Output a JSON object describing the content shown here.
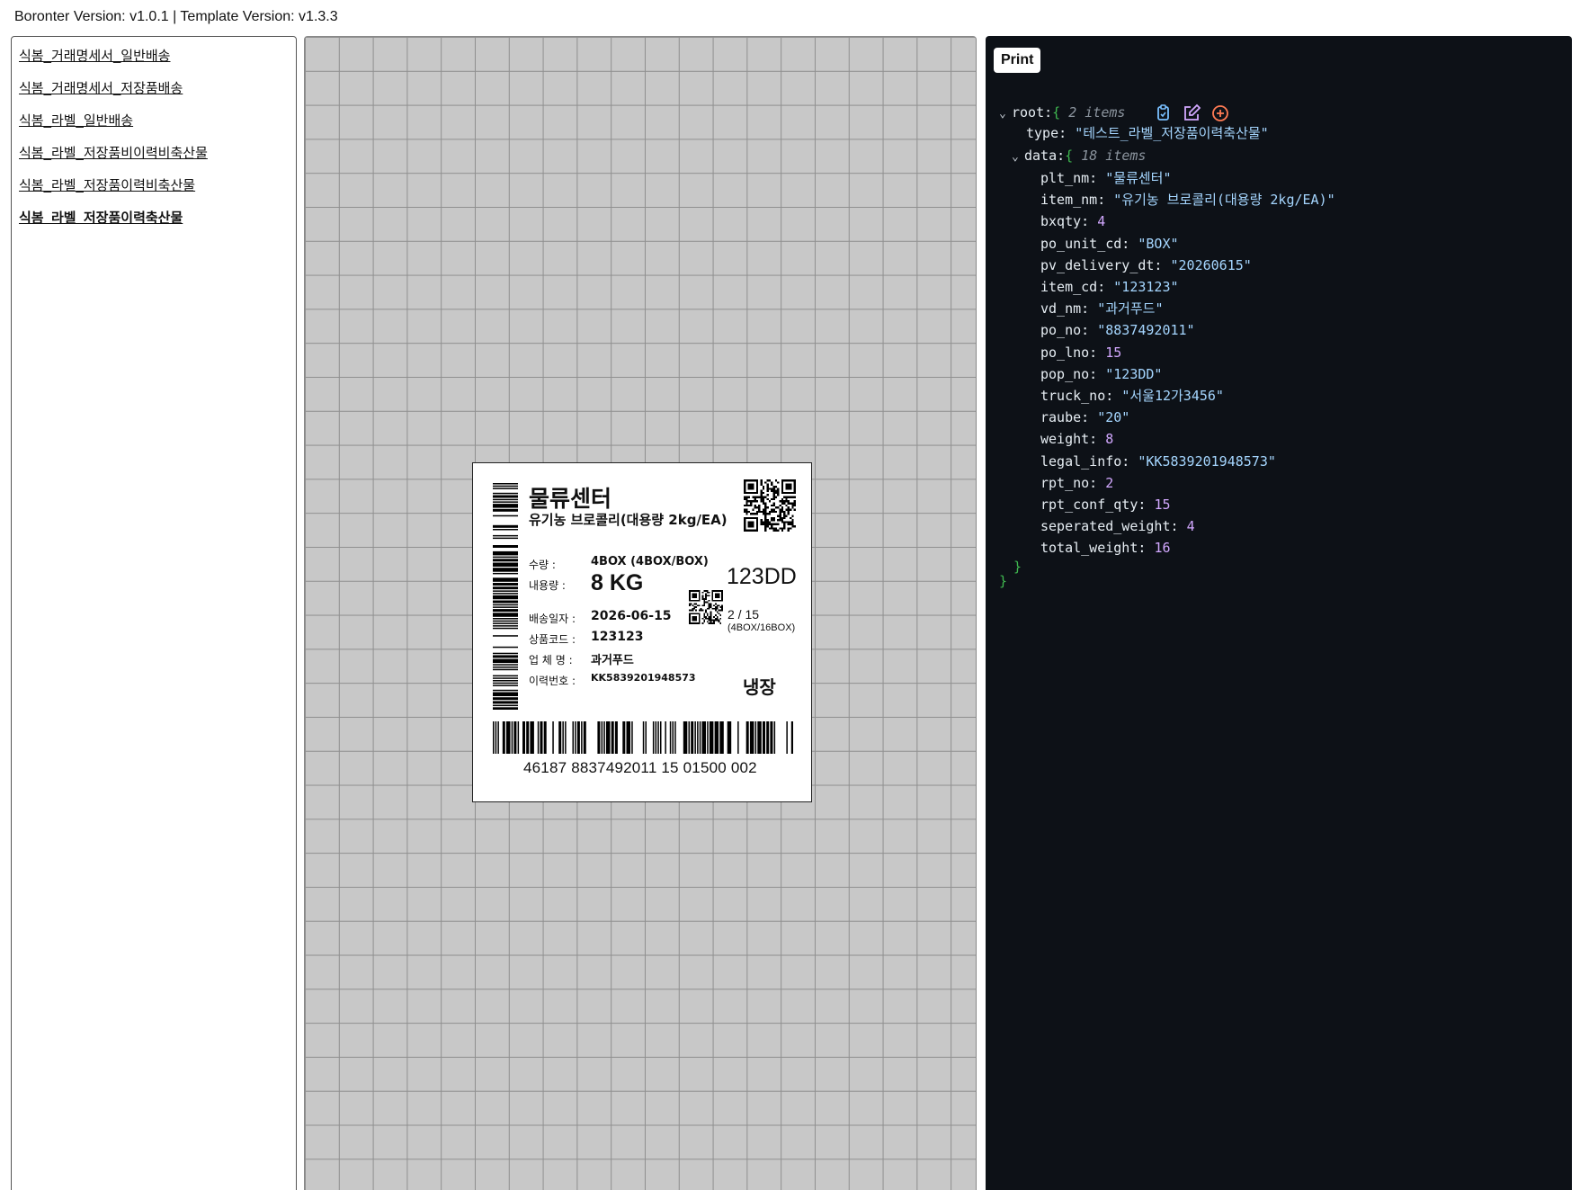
{
  "header": {
    "version_text": "Boronter Version: v1.0.1 | Template Version: v1.3.3"
  },
  "sidebar": {
    "items": [
      {
        "label": "식봄_거래명세서_일반배송",
        "active": false
      },
      {
        "label": "식봄_거래명세서_저장품배송",
        "active": false
      },
      {
        "label": "식봄_라벨_일반배송",
        "active": false
      },
      {
        "label": "식봄_라벨_저장품비이력비축산물",
        "active": false
      },
      {
        "label": "식봄_라벨_저장품이력비축산물",
        "active": false
      },
      {
        "label": "식봄_라벨_저장품이력축산물",
        "active": true
      }
    ]
  },
  "label": {
    "plant_name": "물류센터",
    "item_name": "유기농 브로콜리(대용량 2kg/EA)",
    "quantity_label": "수량 :",
    "quantity_value": "4BOX (4BOX/BOX)",
    "content_label": "내용량 :",
    "content_value": "8 KG",
    "delivery_label": "배송일자 :",
    "delivery_value": "2026-06-15",
    "item_code_label": "상품코드 :",
    "item_code_value": "123123",
    "vendor_label": "업 체 명 :",
    "vendor_value": "과거푸드",
    "trace_label": "이력번호 :",
    "trace_value": "KK5839201948573",
    "pop_no": "123DD",
    "sequence": "2 / 15",
    "sequence_sub": "(4BOX/16BOX)",
    "storage": "냉장",
    "barcode_number": "46187  8837492011  15  01500  002"
  },
  "json_viewer": {
    "print_label": "Print",
    "root_key": "root:",
    "root_meta": "2 items",
    "data_key": "data:",
    "data_meta": "18 items",
    "open_brace": "{",
    "close_brace": "}",
    "icons": [
      "copy-icon",
      "edit-icon",
      "add-icon"
    ],
    "type_entry": {
      "key": "type:",
      "value": "\"테스트_라벨_저장품이력축산물\""
    },
    "entries": [
      {
        "key": "plt_nm:",
        "value": "\"물류센터\"",
        "kind": "str"
      },
      {
        "key": "item_nm:",
        "value": "\"유기농 브로콜리(대용량 2kg/EA)\"",
        "kind": "str"
      },
      {
        "key": "bxqty:",
        "value": "4",
        "kind": "num"
      },
      {
        "key": "po_unit_cd:",
        "value": "\"BOX\"",
        "kind": "str"
      },
      {
        "key": "pv_delivery_dt:",
        "value": "\"20260615\"",
        "kind": "str"
      },
      {
        "key": "item_cd:",
        "value": "\"123123\"",
        "kind": "str"
      },
      {
        "key": "vd_nm:",
        "value": "\"과거푸드\"",
        "kind": "str"
      },
      {
        "key": "po_no:",
        "value": "\"8837492011\"",
        "kind": "str"
      },
      {
        "key": "po_lno:",
        "value": "15",
        "kind": "num"
      },
      {
        "key": "pop_no:",
        "value": "\"123DD\"",
        "kind": "str"
      },
      {
        "key": "truck_no:",
        "value": "\"서울12가3456\"",
        "kind": "str"
      },
      {
        "key": "raube:",
        "value": "\"20\"",
        "kind": "str"
      },
      {
        "key": "weight:",
        "value": "8",
        "kind": "num"
      },
      {
        "key": "legal_info:",
        "value": "\"KK5839201948573\"",
        "kind": "str"
      },
      {
        "key": "rpt_no:",
        "value": "2",
        "kind": "num"
      },
      {
        "key": "rpt_conf_qty:",
        "value": "15",
        "kind": "num"
      },
      {
        "key": "seperated_weight:",
        "value": "4",
        "kind": "num"
      },
      {
        "key": "total_weight:",
        "value": "16",
        "kind": "num"
      }
    ]
  },
  "colors": {
    "json_background": "#0d1117",
    "json_string": "#a5d6ff",
    "json_number": "#d2a8ff",
    "json_brace": "#3fb950",
    "canvas_grid": "#c8c8c8"
  }
}
